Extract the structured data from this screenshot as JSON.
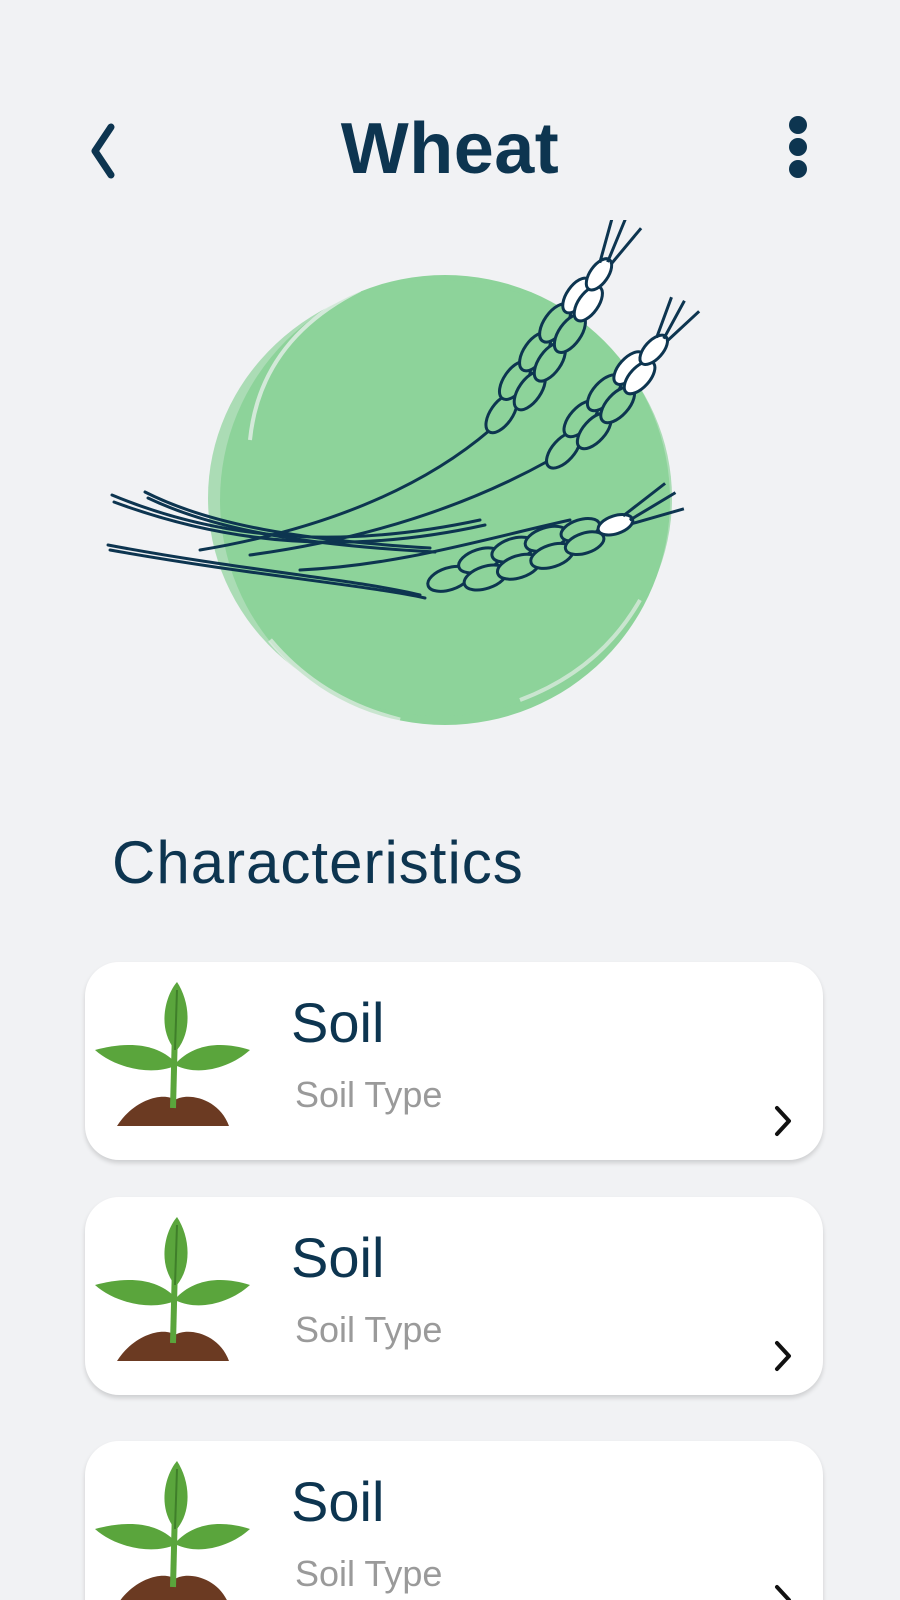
{
  "header": {
    "title": "Wheat",
    "back_icon": "chevron-left-icon",
    "more_icon": "more-vertical-icon"
  },
  "hero": {
    "image": "wheat-illustration",
    "circle_color": "#8dd39a"
  },
  "section": {
    "title": "Characteristics"
  },
  "characteristics": [
    {
      "title": "Soil",
      "subtitle": "Soil Type",
      "icon": "plant-sprout-icon"
    },
    {
      "title": "Soil",
      "subtitle": "Soil Type",
      "icon": "plant-sprout-icon"
    },
    {
      "title": "Soil",
      "subtitle": "Soil Type",
      "icon": "plant-sprout-icon"
    }
  ],
  "colors": {
    "primary_text": "#0d3550",
    "secondary_text": "#9a9a9a",
    "background": "#f1f2f4",
    "card": "#ffffff",
    "leaf_green": "#5aa53c",
    "soil_brown": "#6b3a22"
  }
}
